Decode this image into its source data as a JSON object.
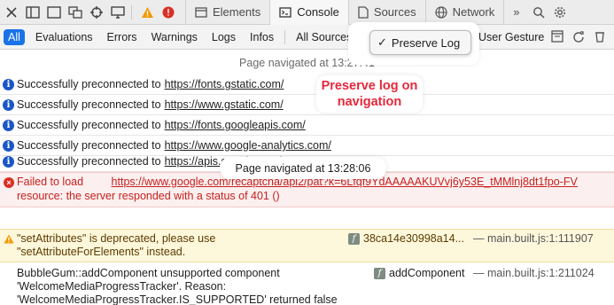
{
  "tabs": [
    {
      "label": "Elements"
    },
    {
      "label": "Console"
    },
    {
      "label": "Sources"
    },
    {
      "label": "Network"
    }
  ],
  "overflow": "»",
  "filters": {
    "all": "All",
    "evaluations": "Evaluations",
    "errors": "Errors",
    "warnings": "Warnings",
    "logs": "Logs",
    "infos": "Infos",
    "sources_select": "All Sources",
    "user_gesture": "User Gesture"
  },
  "popup": {
    "check": "✓",
    "label": "Preserve Log"
  },
  "callout": {
    "line1": "Preserve log on",
    "line2": "navigation"
  },
  "nav1": "Page navigated at 13:27:41",
  "nav2": "Page navigated at 13:28:06",
  "preconnect_prefix": "Successfully preconnected to",
  "preconnects": [
    "https://fonts.gstatic.com/",
    "https://www.gstatic.com/",
    "https://fonts.googleapis.com/",
    "https://www.google-analytics.com/",
    "https://apis.google.com/"
  ],
  "error": {
    "prefix": "Failed to load",
    "url": "https://www.google.com/recaptcha/api2/pat?k=6Lfqf9YdAAAAAKUVvj6y53E_tMMlnj8dt1fpo-FV",
    "line2": "resource: the server responded with a status of 401 ()"
  },
  "warning": {
    "line1": "\"setAttributes\" is deprecated, please use",
    "line2": "\"setAttributeForElements\" instead.",
    "func": "38ca14e30998a14...",
    "source": "main.built.js:1:111907"
  },
  "log": {
    "line1": "BubbleGum::addComponent unsupported component",
    "line2": "'WelcomeMediaProgressTracker'. Reason:",
    "line3": "'WelcomeMediaProgressTracker.IS_SUPPORTED' returned false",
    "func": "addComponent",
    "source": "main.built.js:1:211024"
  }
}
